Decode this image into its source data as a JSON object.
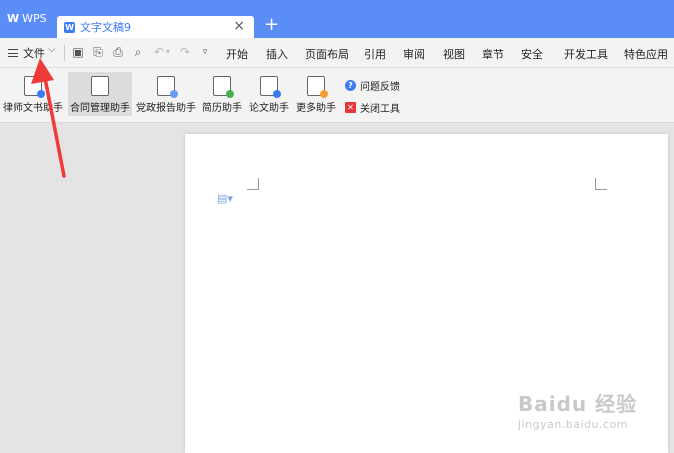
{
  "app": {
    "name": "WPS"
  },
  "tab": {
    "title": "文字文稿9",
    "close": "×",
    "new_tab": "+"
  },
  "menubar": {
    "file": "文件",
    "items": [
      "开始",
      "插入",
      "页面布局",
      "引用",
      "审阅",
      "视图",
      "章节",
      "安全",
      "开发工具",
      "特色应用"
    ]
  },
  "ribbon": {
    "buttons": [
      "律师文书助手",
      "合同管理助手",
      "党政报告助手",
      "简历助手",
      "论文助手",
      "更多助手"
    ],
    "side": {
      "feedback": "问题反馈",
      "close_tool": "关闭工具"
    }
  },
  "watermark": {
    "brand": "Baidu 经验",
    "url": "jingyan.baidu.com"
  },
  "colors": {
    "titlebar": "#5b8df7",
    "accent": "#3b7cf5",
    "arrow": "#f03a3a"
  }
}
